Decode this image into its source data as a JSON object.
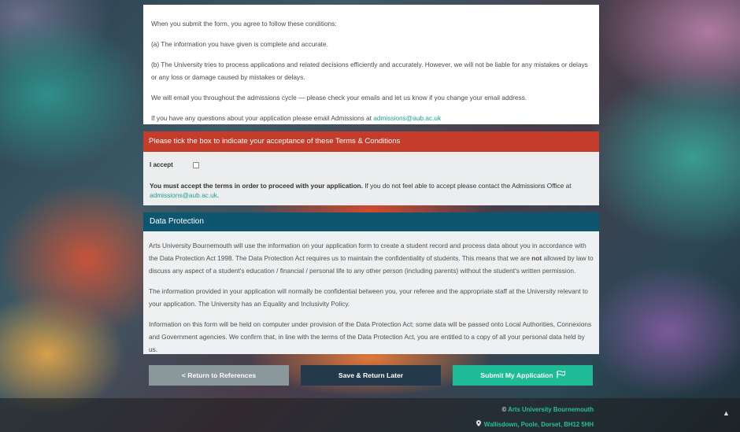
{
  "terms": {
    "intro": "When you submit the form, you agree to follow these conditions:",
    "condition_a": "(a) The information you have given is complete and accurate.",
    "condition_b": "(b) The University tries to process applications and related decisions efficiently and accurately. However, we will not be liable for any mistakes or delays or any loss or damage caused by mistakes or delays.",
    "email_notice": "We will email you throughout the admissions cycle — please check your emails and let us know if you change your email address.",
    "questions_text": "If you have any questions about your application please email Admissions at",
    "questions_email": "admissions@aub.ac.uk"
  },
  "acceptance": {
    "heading": "Please tick the box to indicate your acceptance of these Terms & Conditions",
    "checkbox_label": "I accept",
    "note_bold": "You must accept the terms in order to proceed with your application.",
    "note_text": " If you do not feel able to accept please contact the Admissions Office at ",
    "note_email": "admissions@aub.ac.uk",
    "note_end": "."
  },
  "data_protection": {
    "heading": "Data Protection",
    "p1_a": "Arts University Bournemouth will use the information on your application form to create a student record and process data about you in accordance with the Data Protection Act 1998. The Data Protection Act requires us to maintain the confidentiality of students. This means that we are ",
    "p1_bold": "not",
    "p1_b": " allowed by law to discuss any aspect of a student's education / financial / personal life to any other person (including parents) without the student's written permission.",
    "p2": "The information provided in your application will normally be confidential between you, your referee and the appropriate staff at the University relevant to your application. The University has an Equality and Inclusivity Policy.",
    "p3": "Information on this form will be held on computer under provision of the Data Protection Act; some data will be passed onto Local Authorities, Connexions and Government agencies. We confirm that, in line with the terms of the Data Protection Act, you are entitled to a copy of all your personal data held by us."
  },
  "buttons": {
    "return_label": "< Return to References",
    "save_label": "Save & Return Later",
    "submit_label": "Submit My Application"
  },
  "footer": {
    "copyright_symbol": "©",
    "org_name": "Arts University Bournemouth",
    "address": "Wallisdown, Poole, Dorset, BH12 5HH"
  },
  "icons": {
    "flag": "flag-icon",
    "location": "map-marker-icon",
    "scroll_top": "arrow-up-icon"
  },
  "colors": {
    "accept_header": "#c63c2a",
    "dp_header": "#0e5570",
    "submit": "#1dbc97",
    "save": "#233a4c",
    "return": "#8a979b",
    "link": "#1aa190"
  }
}
